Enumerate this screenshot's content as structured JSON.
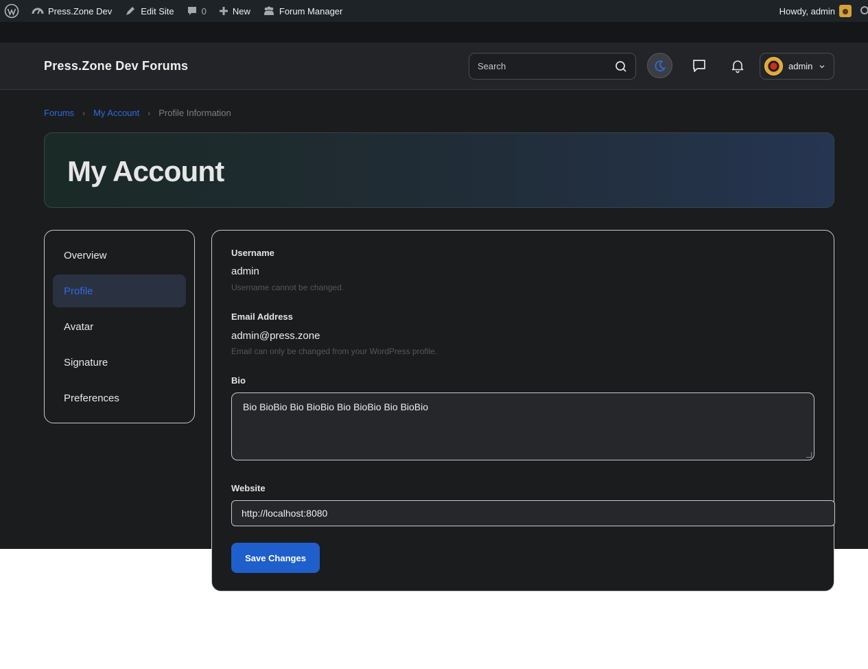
{
  "admin_bar": {
    "site_name": "Press.Zone Dev",
    "edit_site": "Edit Site",
    "comments_count": "0",
    "new_label": "New",
    "forum_manager": "Forum Manager",
    "howdy": "Howdy, admin",
    "icons": [
      "wordpress-logo-icon",
      "dashboard-icon",
      "pencil-icon",
      "comment-icon",
      "plus-icon",
      "groups-icon",
      "search-icon"
    ]
  },
  "header": {
    "site_title": "Press.Zone Dev Forums",
    "search_placeholder": "Search",
    "user_name": "admin"
  },
  "breadcrumb": {
    "items": [
      "Forums",
      "My Account"
    ],
    "current": "Profile Information"
  },
  "hero": {
    "title": "My Account"
  },
  "sidenav": {
    "items": [
      {
        "label": "Overview",
        "active": false
      },
      {
        "label": "Profile",
        "active": true
      },
      {
        "label": "Avatar",
        "active": false
      },
      {
        "label": "Signature",
        "active": false
      },
      {
        "label": "Preferences",
        "active": false
      }
    ]
  },
  "form": {
    "username_label": "Username",
    "username_value": "admin",
    "username_help": "Username cannot be changed.",
    "email_label": "Email Address",
    "email_value": "admin@press.zone",
    "email_help": "Email can only be changed from your WordPress profile.",
    "bio_label": "Bio",
    "bio_value": "Bio BioBio Bio BioBio Bio BioBio Bio BioBio",
    "website_label": "Website",
    "website_value": "http://localhost:8080",
    "save_label": "Save Changes"
  },
  "colors": {
    "accent": "#1f5fcc",
    "link": "#2f6be0",
    "page_bg": "#1b1c1e"
  }
}
